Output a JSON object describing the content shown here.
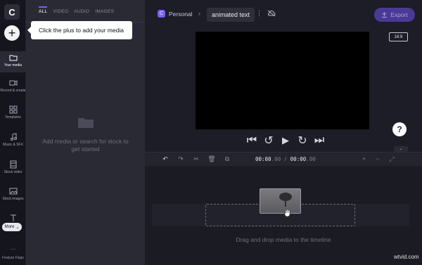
{
  "app": {
    "logo_letter": "C"
  },
  "sidebar": {
    "items": [
      {
        "label": "Your media",
        "icon": "folder-icon"
      },
      {
        "label": "Record & create",
        "icon": "camera-icon"
      },
      {
        "label": "Templates",
        "icon": "templates-icon"
      },
      {
        "label": "Music & SFX",
        "icon": "music-icon"
      },
      {
        "label": "Stock video",
        "icon": "film-icon"
      },
      {
        "label": "Stock images",
        "icon": "image-icon"
      },
      {
        "label": "Text",
        "icon": "text-icon"
      }
    ],
    "more_label": "More",
    "feature_flags_label": "Feature Flags"
  },
  "media_panel": {
    "tabs": [
      "ALL",
      "VIDEO",
      "AUDIO",
      "IMAGES"
    ],
    "active_tab": "ALL",
    "empty_text": "Add media or search for stock to get started"
  },
  "tooltip": {
    "text": "Click the plus to add your media"
  },
  "header": {
    "workspace_badge": "C",
    "workspace": "Personal",
    "crumb_separator": "›",
    "project_title": "animated text",
    "export_label": "Export"
  },
  "preview": {
    "aspect_ratio": "16:9",
    "help_label": "?"
  },
  "timeline": {
    "current_time_main": "00:00",
    "current_time_frac": ".00",
    "separator": " / ",
    "total_time_main": "00:00",
    "total_time_frac": ".00",
    "drop_text": "Drag and drop media to the timeline"
  },
  "watermark": {
    "text": "wtvid.com"
  },
  "colors": {
    "accent": "#7c5cff",
    "export_bg": "#4a3a96",
    "background": "#1d1d27"
  }
}
